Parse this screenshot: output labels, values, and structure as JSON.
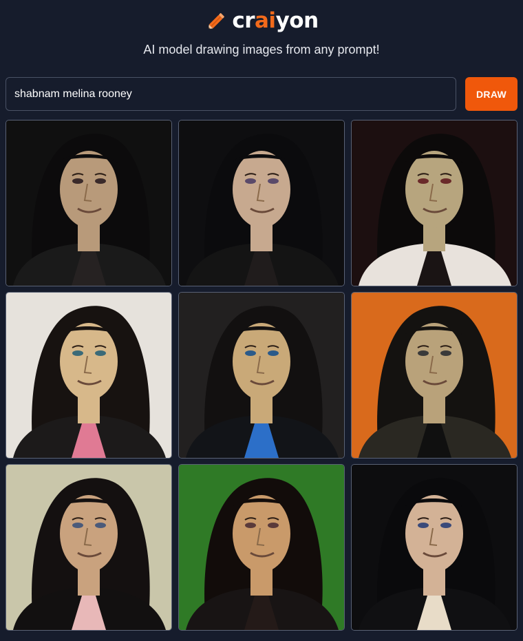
{
  "header": {
    "logo_prefix": "cr",
    "logo_accent": "ai",
    "logo_suffix": "yon",
    "logo_icon": "pencil-icon",
    "tagline": "AI model drawing images from any prompt!"
  },
  "prompt": {
    "value": "shabnam melina rooney",
    "draw_label": "DRAW"
  },
  "colors": {
    "background": "#161c2c",
    "accent": "#f26a1b",
    "button": "#f0580b"
  },
  "results": [
    {
      "bg": "#101010",
      "hair": "#0c0b0c",
      "skin": "#b89a7a",
      "top": "#1a1a1a",
      "inner": "#262222",
      "eyes": "#3a2a2a"
    },
    {
      "bg": "#0e0e10",
      "hair": "#0b0b0d",
      "skin": "#c7a98f",
      "top": "#141414",
      "inner": "#201c1c",
      "eyes": "#5a4a6a"
    },
    {
      "bg": "#1c0f10",
      "hair": "#0c0a0a",
      "skin": "#b7a57e",
      "top": "#e8e2dc",
      "inner": "#1a1414",
      "eyes": "#6a2a2a"
    },
    {
      "bg": "#e6e2dc",
      "hair": "#171210",
      "skin": "#d7b88a",
      "top": "#1c1a1a",
      "inner": "#e07a94",
      "eyes": "#3a6a78"
    },
    {
      "bg": "#222020",
      "hair": "#121010",
      "skin": "#c9a978",
      "top": "#121418",
      "inner": "#2c6fc8",
      "eyes": "#2a5a8a"
    },
    {
      "bg": "#d96a1c",
      "hair": "#141210",
      "skin": "#b9a27a",
      "top": "#2a2822",
      "inner": "#101010",
      "eyes": "#3a3a3a"
    },
    {
      "bg": "#c9c6aa",
      "hair": "#141010",
      "skin": "#c9a27e",
      "top": "#121010",
      "inner": "#e8b8b8",
      "eyes": "#4a5a7a"
    },
    {
      "bg": "#2f7a26",
      "hair": "#120c0a",
      "skin": "#c99a6a",
      "top": "#181414",
      "inner": "#241a18",
      "eyes": "#5a3a3a"
    },
    {
      "bg": "#0d0d0f",
      "hair": "#0a0a0c",
      "skin": "#d3b296",
      "top": "#101012",
      "inner": "#e8dcc8",
      "eyes": "#3a4a7a"
    }
  ]
}
